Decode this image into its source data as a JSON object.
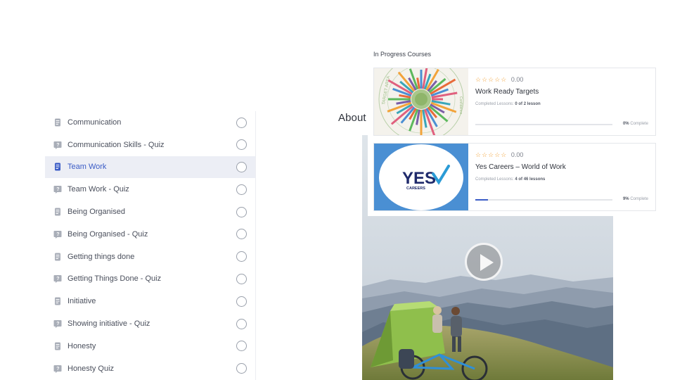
{
  "lessons": [
    {
      "label": "Communication",
      "type": "lesson",
      "active": false
    },
    {
      "label": "Communication Skills - Quiz",
      "type": "quiz",
      "active": false
    },
    {
      "label": "Team Work",
      "type": "lesson",
      "active": true
    },
    {
      "label": "Team Work - Quiz",
      "type": "quiz",
      "active": false
    },
    {
      "label": "Being Organised",
      "type": "lesson",
      "active": false
    },
    {
      "label": "Being Organised - Quiz",
      "type": "quiz",
      "active": false
    },
    {
      "label": "Getting things done",
      "type": "lesson",
      "active": false
    },
    {
      "label": "Getting Things Done - Quiz",
      "type": "quiz",
      "active": false
    },
    {
      "label": "Initiative",
      "type": "lesson",
      "active": false
    },
    {
      "label": "Showing initiative - Quiz",
      "type": "quiz",
      "active": false
    },
    {
      "label": "Honesty",
      "type": "lesson",
      "active": false
    },
    {
      "label": "Honesty Quiz",
      "type": "quiz",
      "active": false
    }
  ],
  "about": {
    "heading": "About"
  },
  "in_progress": {
    "title": "In Progress Courses",
    "courses": [
      {
        "stars": "☆☆☆☆☆",
        "rating": "0.00",
        "title": "Work Ready Targets",
        "lessons_prefix": "Completed Lessons:",
        "lessons_value": "0 of 2 lesson",
        "percent_label": "0%",
        "complete_label": "Complete",
        "progress": 0.0,
        "thumb": "radial-target-chart"
      },
      {
        "stars": "☆☆☆☆☆",
        "rating": "0.00",
        "title": "Yes Careers – World of Work",
        "lessons_prefix": "Completed Lessons:",
        "lessons_value": "4 of 46 lessons",
        "percent_label": "9%",
        "complete_label": "Complete",
        "progress": 0.09,
        "thumb": "yes-careers-logo",
        "logo_text": "YES",
        "logo_subtext": "CAREERS"
      }
    ]
  },
  "video": {
    "thumbnail": "camping-tent-mountains",
    "play_icon": "play-icon"
  },
  "colors": {
    "accent": "#3b5cc6",
    "active_row_bg": "#eceef5",
    "star": "#f2a33a",
    "logo_blue": "#4a8fd3",
    "logo_navy": "#1f2a6b",
    "logo_check": "#2a9bd6"
  }
}
